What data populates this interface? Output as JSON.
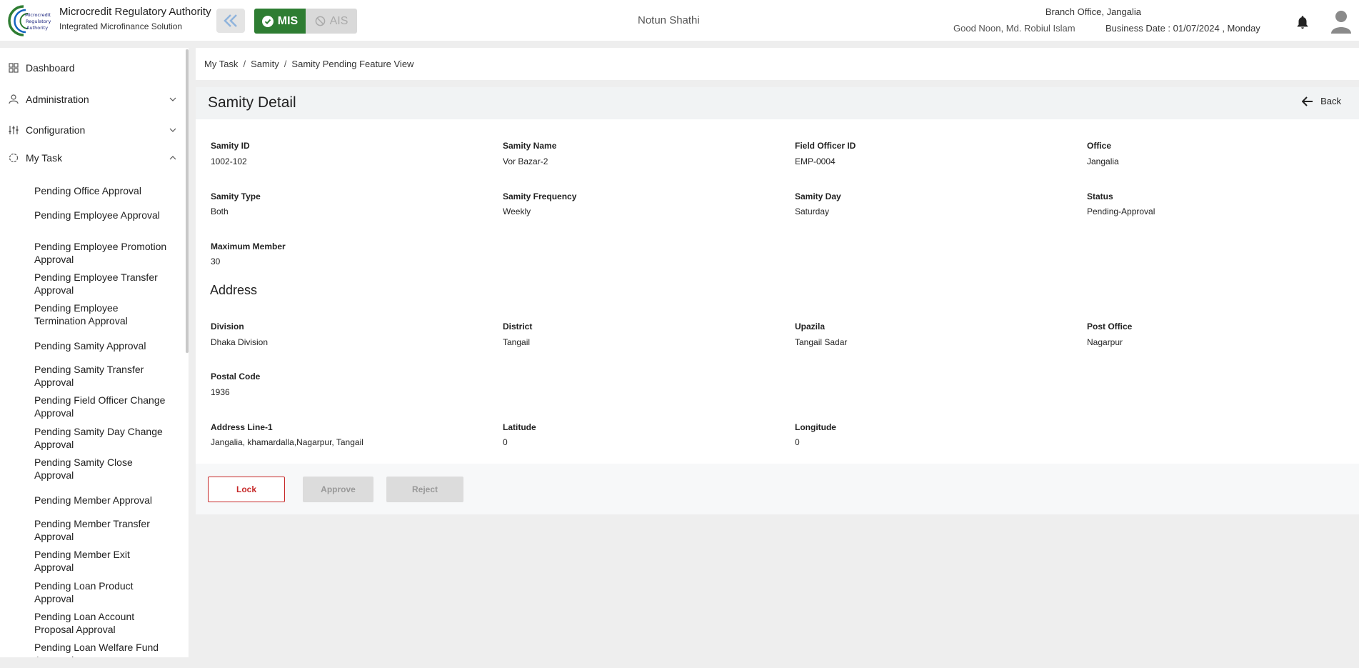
{
  "header": {
    "org_title": "Microcredit Regulatory Authority",
    "org_subtitle": "Integrated Microfinance Solution",
    "logo_text": "Microcredit Regulatory Authority",
    "mode_mis": "MIS",
    "mode_ais": "AIS",
    "app_name": "Notun Shathi",
    "greeting": "Good Noon, Md. Robiul Islam",
    "branch": "Branch Office, Jangalia",
    "business_date": "Business Date : 01/07/2024 , Monday",
    "accent_color": "#2e7d32"
  },
  "sidebar": {
    "dashboard": "Dashboard",
    "administration": "Administration",
    "configuration": "Configuration",
    "my_task": "My Task",
    "tasks": [
      "Pending Office Approval",
      "Pending Employee Approval",
      "Pending Employee Promotion Approval",
      "Pending Employee Transfer Approval",
      "Pending Employee Termination Approval",
      "Pending Samity Approval",
      "Pending Samity Transfer Approval",
      "Pending Field Officer Change Approval",
      "Pending Samity Day Change Approval",
      "Pending Samity Close Approval",
      "Pending Member Approval",
      "Pending Member Transfer Approval",
      "Pending Member Exit Approval",
      "Pending Loan Product Approval",
      "Pending Loan Account Proposal Approval",
      "Pending Loan Welfare Fund Approval"
    ]
  },
  "breadcrumb": {
    "items": [
      "My Task",
      "Samity",
      "Samity Pending Feature View"
    ],
    "separator": "/"
  },
  "detail": {
    "title": "Samity Detail",
    "back_label": "Back",
    "fields": {
      "samity_id": {
        "label": "Samity ID",
        "value": "1002-102"
      },
      "samity_name": {
        "label": "Samity Name",
        "value": "Vor Bazar-2"
      },
      "field_officer_id": {
        "label": "Field Officer ID",
        "value": "EMP-0004"
      },
      "office": {
        "label": "Office",
        "value": "Jangalia"
      },
      "samity_type": {
        "label": "Samity Type",
        "value": "Both"
      },
      "samity_frequency": {
        "label": "Samity Frequency",
        "value": "Weekly"
      },
      "samity_day": {
        "label": "Samity Day",
        "value": "Saturday"
      },
      "status": {
        "label": "Status",
        "value": "Pending-Approval"
      },
      "maximum_member": {
        "label": "Maximum Member",
        "value": "30"
      }
    },
    "address_title": "Address",
    "address": {
      "division": {
        "label": "Division",
        "value": "Dhaka Division"
      },
      "district": {
        "label": "District",
        "value": "Tangail"
      },
      "upazila": {
        "label": "Upazila",
        "value": "Tangail Sadar"
      },
      "post_office": {
        "label": "Post Office",
        "value": "Nagarpur"
      },
      "postal_code": {
        "label": "Postal Code",
        "value": "1936"
      },
      "address_line_1": {
        "label": "Address Line-1",
        "value": "Jangalia, khamardalla,Nagarpur, Tangail"
      },
      "latitude": {
        "label": "Latitude",
        "value": "0"
      },
      "longitude": {
        "label": "Longitude",
        "value": "0"
      }
    },
    "actions": {
      "lock": "Lock",
      "approve": "Approve",
      "reject": "Reject"
    }
  }
}
